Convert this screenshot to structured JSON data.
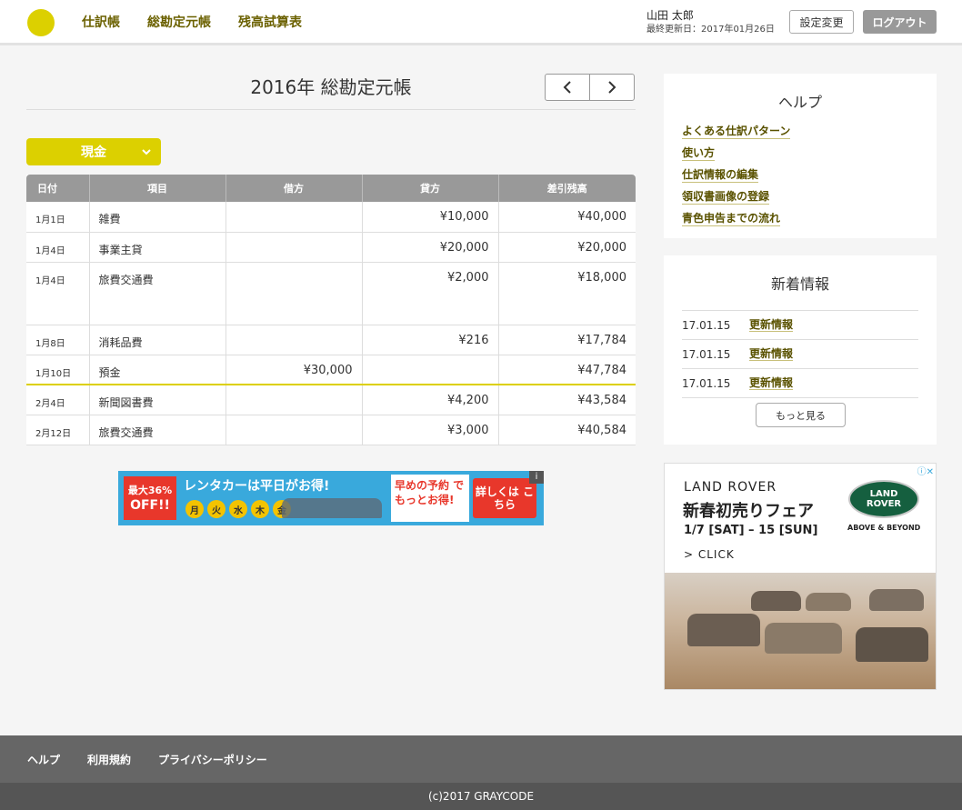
{
  "header": {
    "nav": [
      "仕訳帳",
      "総勘定元帳",
      "残高試算表"
    ],
    "user_name": "山田 太郎",
    "last_updated": "最終更新日：2017年01月26日",
    "settings_label": "設定変更",
    "logout_label": "ログアウト"
  },
  "colors": {
    "accent": "#dcd000",
    "nav_text": "#6b6100",
    "footer": "#666666"
  },
  "main": {
    "title": "2016年 総勘定元帳",
    "prev_icon": "chevron-left-icon",
    "next_icon": "chevron-right-icon",
    "account": "現金",
    "table": {
      "headers": [
        "日付",
        "項目",
        "借方",
        "貸方",
        "差引残高"
      ],
      "rows": [
        {
          "date": "1月1日",
          "item": "雑費",
          "debit": "",
          "credit": "¥10,000",
          "balance": "¥40,000"
        },
        {
          "date": "1月4日",
          "item": "事業主貸",
          "debit": "",
          "credit": "¥20,000",
          "balance": "¥20,000"
        },
        {
          "date": "1月4日",
          "item": "旅費交通費",
          "debit": "",
          "credit": "¥2,000",
          "balance": "¥18,000"
        },
        {
          "date": "1月8日",
          "item": "消耗品費",
          "debit": "",
          "credit": "¥216",
          "balance": "¥17,784"
        },
        {
          "date": "1月10日",
          "item": "預金",
          "debit": "¥30,000",
          "credit": "",
          "balance": "¥47,784"
        },
        {
          "date": "2月4日",
          "item": "新聞図書費",
          "debit": "",
          "credit": "¥4,200",
          "balance": "¥43,584"
        },
        {
          "date": "2月12日",
          "item": "旅費交通費",
          "debit": "",
          "credit": "¥3,000",
          "balance": "¥40,584"
        }
      ]
    }
  },
  "ad_banner": {
    "off_line1": "最大36%",
    "off_line2": "OFF!!",
    "headline": "レンタカーは平日がお得!",
    "days": [
      "月",
      "火",
      "水",
      "木",
      "金"
    ],
    "book": "早めの予約 でもっとお得!",
    "detail": "詳しくは こちら"
  },
  "sidebar": {
    "help_title": "ヘルプ",
    "help_links": [
      "よくある仕訳パターン",
      "使い方",
      "仕訳情報の編集",
      "領収書画像の登録",
      "青色申告までの流れ"
    ],
    "news_title": "新着情報",
    "news": [
      {
        "date": "17.01.15",
        "label": "更新情報"
      },
      {
        "date": "17.01.15",
        "label": "更新情報"
      },
      {
        "date": "17.01.15",
        "label": "更新情報"
      }
    ],
    "more_label": "もっと見る"
  },
  "side_ad": {
    "brand": "LAND ROVER",
    "headline": "新春初売りフェア",
    "dates": "1/7 [SAT] – 15 [SUN]",
    "click": "> CLICK",
    "logo_line1": "LAND",
    "logo_line2": "ROVER",
    "tagline": "ABOVE & BEYOND"
  },
  "footer": {
    "links": [
      "ヘルプ",
      "利用規約",
      "プライバシーポリシー"
    ],
    "copyright": "(c)2017 GRAYCODE"
  }
}
